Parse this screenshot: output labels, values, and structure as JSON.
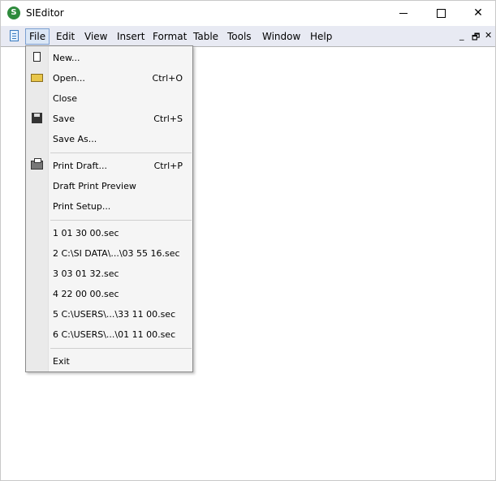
{
  "window": {
    "title": "SIEditor",
    "app_icon": "S",
    "controls": {
      "minimize": "–",
      "maximize": "□",
      "close": "✕"
    }
  },
  "menubar": {
    "items": [
      "File",
      "Edit",
      "View",
      "Insert",
      "Format",
      "Table",
      "Tools",
      "Window",
      "Help"
    ],
    "active": "File",
    "mdi_controls": {
      "minimize": "_",
      "restore": "🗗",
      "close": "✕"
    }
  },
  "file_menu": {
    "items": [
      {
        "label": "New...",
        "shortcut": "",
        "icon": "new-document-icon"
      },
      {
        "label": "Open...",
        "shortcut": "Ctrl+O",
        "icon": "open-folder-icon"
      },
      {
        "label": "Close",
        "shortcut": "",
        "icon": ""
      },
      {
        "label": "Save",
        "shortcut": "Ctrl+S",
        "icon": "save-disk-icon"
      },
      {
        "label": "Save As...",
        "shortcut": "",
        "icon": ""
      },
      {
        "label": "Print Draft...",
        "shortcut": "Ctrl+P",
        "icon": "printer-icon"
      },
      {
        "label": "Draft Print Preview",
        "shortcut": "",
        "icon": ""
      },
      {
        "label": "Print Setup...",
        "shortcut": "",
        "icon": ""
      },
      {
        "label": "1 01 30 00.sec",
        "shortcut": "",
        "icon": ""
      },
      {
        "label": "2 C:\\SI DATA\\...\\03 55 16.sec",
        "shortcut": "",
        "icon": ""
      },
      {
        "label": "3 03 01 32.sec",
        "shortcut": "",
        "icon": ""
      },
      {
        "label": "4 22 00 00.sec",
        "shortcut": "",
        "icon": ""
      },
      {
        "label": "5 C:\\USERS\\...\\33 11 00.sec",
        "shortcut": "",
        "icon": ""
      },
      {
        "label": "6 C:\\USERS\\...\\01 11 00.sec",
        "shortcut": "",
        "icon": ""
      },
      {
        "label": "Exit",
        "shortcut": "",
        "icon": ""
      }
    ]
  }
}
